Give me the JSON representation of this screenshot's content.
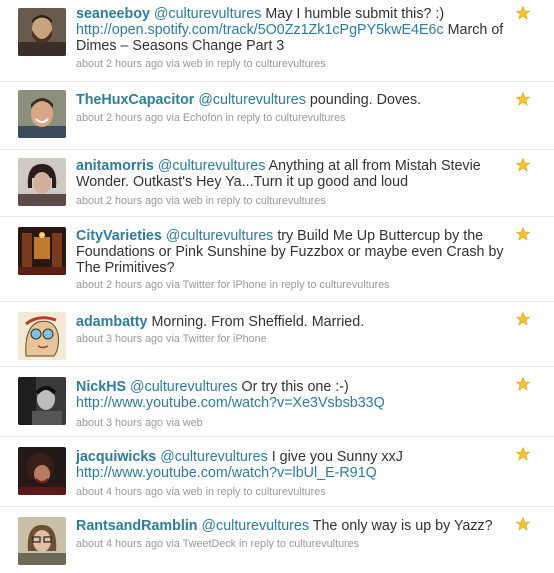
{
  "tweets": [
    {
      "user": "seaneeboy",
      "mention": "@culturevultures",
      "text": "May I humble submit this? :)",
      "link": "http://open.spotify.com/track/5O0Zz1Zk1cPgPY5kwE4E6c",
      "after": "March of Dimes – Seasons Change Part 3",
      "meta": "about 2 hours ago via web in reply to culturevultures",
      "avatar_icon": "avatar-bearded-man-icon"
    },
    {
      "user": "TheHuxCapacitor",
      "mention": "@culturevultures",
      "text": "pounding. Doves.",
      "link": "",
      "after": "",
      "meta": "about 2 hours ago via Echofon in reply to culturevultures",
      "avatar_icon": "avatar-smiling-man-icon"
    },
    {
      "user": "anitamorris",
      "mention": "@culturevultures",
      "text": "Anything at all from Mistah Stevie Wonder. Outkast's Hey Ya...Turn it up good and loud",
      "link": "",
      "after": "",
      "meta": "about 2 hours ago via web in reply to culturevultures",
      "avatar_icon": "avatar-woman-bob-hair-icon"
    },
    {
      "user": "CityVarieties",
      "mention": "@culturevultures",
      "text": "try Build Me Up Buttercup by the Foundations or Pink Sunshine by Fuzzbox or maybe even Crash by The Primitives?",
      "link": "",
      "after": "",
      "meta": "about 2 hours ago via Twitter for iPhone in reply to culturevultures",
      "avatar_icon": "avatar-theatre-interior-icon"
    },
    {
      "user": "adambatty",
      "mention": "",
      "text": "Morning. From Sheffield. Married.",
      "link": "",
      "after": "",
      "meta": "about 3 hours ago via Twitter for iPhone",
      "avatar_icon": "avatar-cartoon-face-icon"
    },
    {
      "user": "NickHS",
      "mention": "@culturevultures",
      "text": "Or try this one :-)",
      "link": "http://www.youtube.com/watch?v=Xe3Vsbsb33Q",
      "after": "",
      "meta": "about 3 hours ago via web",
      "avatar_icon": "avatar-bw-portrait-icon"
    },
    {
      "user": "jacquiwicks",
      "mention": "@culturevultures",
      "text": "I give you Sunny xxJ",
      "link": "http://www.youtube.com/watch?v=lbUl_E-R91Q",
      "after": "",
      "meta": "about 4 hours ago via web in reply to culturevultures",
      "avatar_icon": "avatar-dark-curly-hair-icon"
    },
    {
      "user": "RantsandRamblin",
      "mention": "@culturevultures",
      "text": "The only way is up by Yazz?",
      "link": "",
      "after": "",
      "meta": "about 4 hours ago via TweetDeck in reply to culturevultures",
      "avatar_icon": "avatar-woman-glasses-icon"
    }
  ],
  "colors": {
    "link": "#2f7d9c",
    "meta": "#999999",
    "star": "#f4c430"
  },
  "favorite_icon": "star-icon"
}
